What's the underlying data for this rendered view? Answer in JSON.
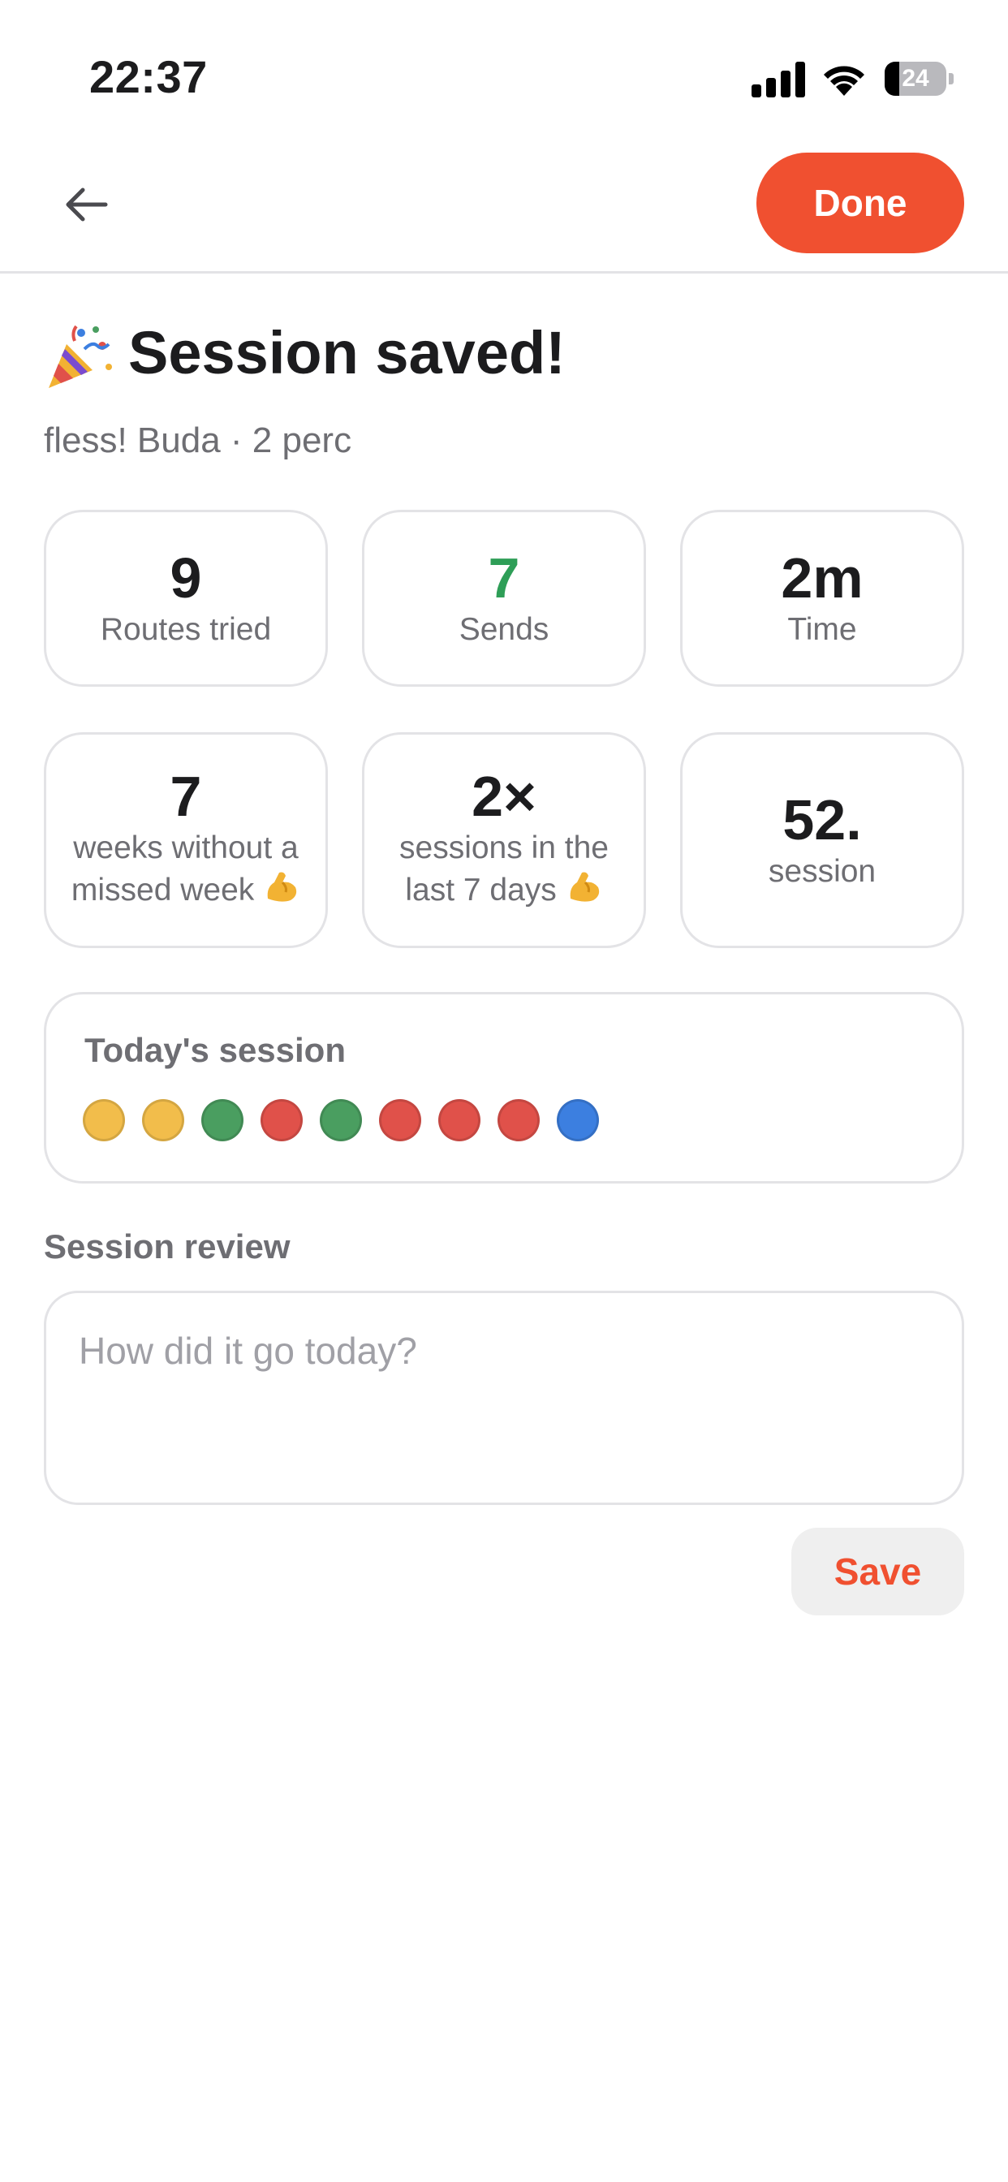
{
  "status_bar": {
    "time": "22:37",
    "battery_percent": "24",
    "battery_level": 0.24
  },
  "header": {
    "done_label": "Done"
  },
  "title": {
    "text": "Session saved!",
    "subtitle": "fless! Buda · 2 perc"
  },
  "stats_row1": [
    {
      "value": "9",
      "label": "Routes tried"
    },
    {
      "value": "7",
      "label": "Sends",
      "color": "#2e9e57"
    },
    {
      "value": "2m",
      "label": "Time"
    }
  ],
  "stats_row2": [
    {
      "value": "7",
      "label_line1": "weeks without a",
      "label_line2": "missed week"
    },
    {
      "value": "2×",
      "label_line1": "sessions in the",
      "label_line2": "last 7 days"
    },
    {
      "value": "52.",
      "label": "session"
    }
  ],
  "today": {
    "title": "Today's session",
    "route_colors": [
      "#f2bd4b",
      "#f2bd4b",
      "#4a9e60",
      "#e0514a",
      "#4a9e60",
      "#e0514a",
      "#e0514a",
      "#e0514a",
      "#3c7fe0"
    ]
  },
  "review": {
    "label": "Session review",
    "placeholder": "How did it go today?",
    "value": "",
    "save_label": "Save"
  },
  "colors": {
    "accent": "#f05030",
    "send_green": "#2e9e57"
  },
  "icons": [
    "back-arrow-icon",
    "party-popper-icon",
    "flexed-biceps-icon"
  ]
}
